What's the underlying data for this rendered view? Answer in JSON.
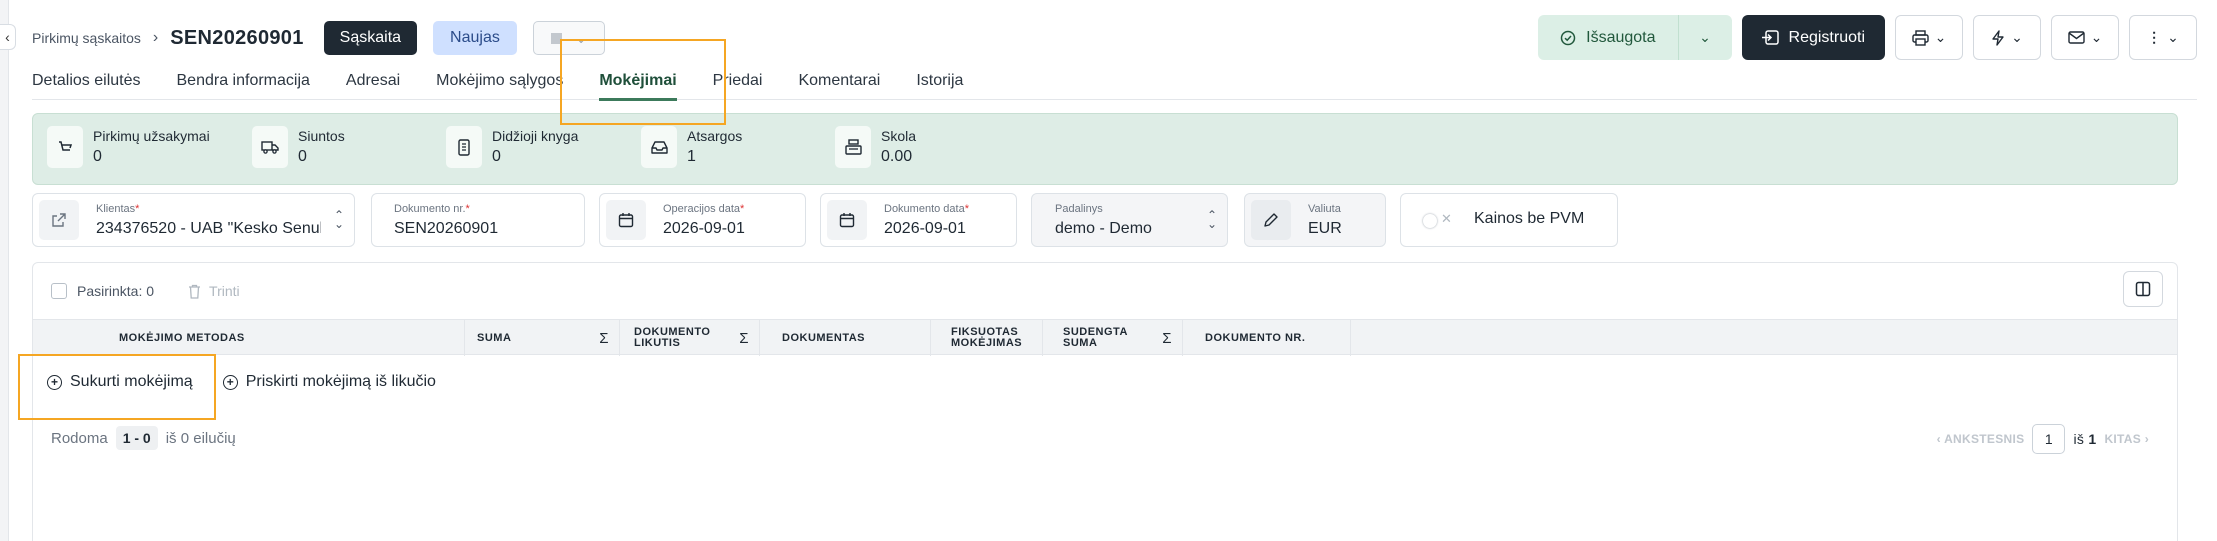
{
  "header": {
    "breadcrumb": "Pirkimų sąskaitos",
    "document_number": "SEN20260901",
    "type_badge": "Sąskaita",
    "status_badge": "Naujas"
  },
  "actions": {
    "saved": "Išsaugota",
    "register": "Registruoti"
  },
  "tabs": [
    {
      "label": "Detalios eilutės"
    },
    {
      "label": "Bendra informacija"
    },
    {
      "label": "Adresai"
    },
    {
      "label": "Mokėjimo sąlygos"
    },
    {
      "label": "Mokėjimai"
    },
    {
      "label": "Priedai"
    },
    {
      "label": "Komentarai"
    },
    {
      "label": "Istorija"
    }
  ],
  "active_tab": "Mokėjimai",
  "stats": [
    {
      "label": "Pirkimų užsakymai",
      "value": "0",
      "icon": "cart-icon"
    },
    {
      "label": "Siuntos",
      "value": "0",
      "icon": "truck-icon"
    },
    {
      "label": "Didžioji knyga",
      "value": "0",
      "icon": "ledger-icon"
    },
    {
      "label": "Atsargos",
      "value": "1",
      "icon": "inbox-icon"
    },
    {
      "label": "Skola",
      "value": "0.00",
      "icon": "register-icon"
    }
  ],
  "fields": {
    "client": {
      "label": "Klientas",
      "value": "234376520 - UAB \"Kesko Senukai"
    },
    "doc_no": {
      "label": "Dokumento nr.",
      "value": "SEN20260901"
    },
    "op_date": {
      "label": "Operacijos data",
      "value": "2026-09-01"
    },
    "doc_date": {
      "label": "Dokumento data",
      "value": "2026-09-01"
    },
    "unit": {
      "label": "Padalinys",
      "value": "demo - Demo"
    },
    "currency": {
      "label": "Valiuta",
      "value": "EUR"
    },
    "prices_no_vat": {
      "label": "Kainos be PVM"
    }
  },
  "table": {
    "selected": "Pasirinkta: 0",
    "delete": "Trinti",
    "columns": [
      {
        "label": "MOKĖJIMO METODAS"
      },
      {
        "label": "SUMA"
      },
      {
        "label": "DOKUMENTO LIKUTIS"
      },
      {
        "label": "DOKUMENTAS"
      },
      {
        "label": "FIKSUOTAS MOKĖJIMAS"
      },
      {
        "label": "SUDENGTA SUMA"
      },
      {
        "label": "DOKUMENTO NR."
      }
    ],
    "create_payment": "Sukurti mokėjimą",
    "assign_payment": "Priskirti mokėjimą iš likučio",
    "sigma": "Σ"
  },
  "pager": {
    "showing": "Rodoma",
    "range": "1 - 0",
    "of_rows": "iš 0 eilučių",
    "prev": "‹ ANKSTESNIS",
    "page": "1",
    "of": "iš",
    "total_pages": "1",
    "next": "KITAS ›"
  }
}
